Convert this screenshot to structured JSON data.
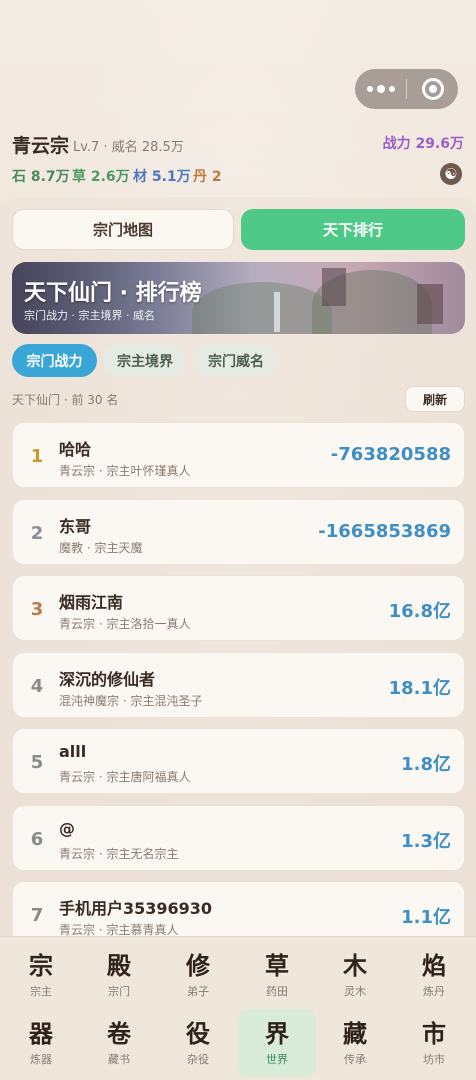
{
  "header": {
    "sect_name": "青云宗",
    "sect_meta": "Lv.7 · 威名 28.5万",
    "power": "战力 29.6万",
    "resources": {
      "stone": "石 8.7万",
      "grass": "草 2.6万",
      "wood": "材 5.1万",
      "pill": "丹 2"
    },
    "taiji_glyph": "☯"
  },
  "tabs": {
    "map": "宗门地图",
    "rank": "天下排行"
  },
  "banner": {
    "title": "天下仙门 · 排行榜",
    "subtitle": "宗门战力 · 宗主境界 · 威名"
  },
  "filters": {
    "power": "宗门战力",
    "realm": "宗主境界",
    "fame": "宗门威名"
  },
  "list": {
    "caption": "天下仙门 · 前 30 名",
    "refresh": "刷新",
    "rows": [
      {
        "rank": "1",
        "name": "哈哈",
        "sub": "青云宗 · 宗主叶怀瑾真人",
        "value": "-763820588",
        "rank_color": "#c69b28"
      },
      {
        "rank": "2",
        "name": "东哥",
        "sub": "魔教 · 宗主天魔",
        "value": "-1665853869",
        "rank_color": "#8a8f99"
      },
      {
        "rank": "3",
        "name": "烟雨江南",
        "sub": "青云宗 · 宗主洛拾一真人",
        "value": "16.8亿",
        "rank_color": "#b97c4a"
      },
      {
        "rank": "4",
        "name": "深沉的修仙者",
        "sub": "混沌神魔宗 · 宗主混沌圣子",
        "value": "18.1亿",
        "rank_color": "#8a8a8a"
      },
      {
        "rank": "5",
        "name": "alll",
        "sub": "青云宗 · 宗主唐阿福真人",
        "value": "1.8亿",
        "rank_color": "#8a8a8a"
      },
      {
        "rank": "6",
        "name": "@",
        "sub": "青云宗 · 宗主无名宗主",
        "value": "1.3亿",
        "rank_color": "#8a8a8a"
      },
      {
        "rank": "7",
        "name": "手机用户35396930",
        "sub": "青云宗 · 宗主慕青真人",
        "value": "1.1亿",
        "rank_color": "#8a8a8a"
      }
    ]
  },
  "nav": [
    {
      "big": "宗",
      "small": "宗主"
    },
    {
      "big": "殿",
      "small": "宗门"
    },
    {
      "big": "修",
      "small": "弟子"
    },
    {
      "big": "草",
      "small": "药田"
    },
    {
      "big": "木",
      "small": "灵木"
    },
    {
      "big": "焰",
      "small": "炼丹"
    },
    {
      "big": "器",
      "small": "炼器"
    },
    {
      "big": "卷",
      "small": "藏书"
    },
    {
      "big": "役",
      "small": "杂役"
    },
    {
      "big": "界",
      "small": "世界"
    },
    {
      "big": "藏",
      "small": "传承"
    },
    {
      "big": "市",
      "small": "坊市"
    }
  ],
  "nav_active_label": "世界"
}
